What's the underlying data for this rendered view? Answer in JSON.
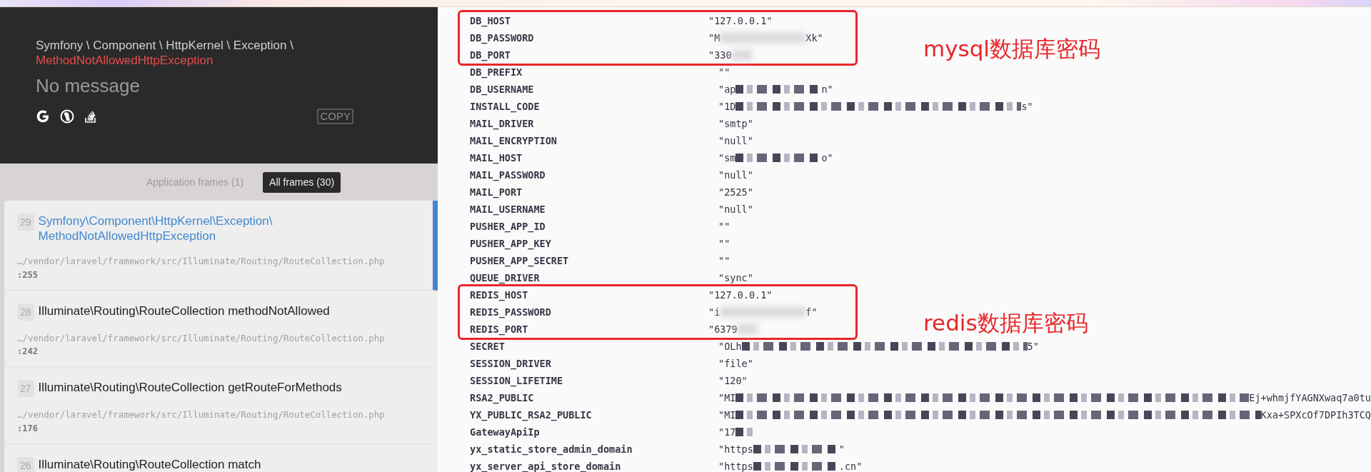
{
  "exception": {
    "namespace": "Symfony \\ Component \\ HttpKernel \\ Exception \\",
    "class": "MethodNotAllowedHttpException",
    "message": "No message",
    "search_links": [
      {
        "kind": "google"
      },
      {
        "kind": "duckduckgo"
      },
      {
        "kind": "stackoverflow"
      }
    ],
    "copy_button": "COPY"
  },
  "frame_tabs": [
    {
      "label": "Application frames (1)",
      "selected": false
    },
    {
      "label": "All frames (30)",
      "selected": true
    }
  ],
  "frames": [
    {
      "index": "29",
      "title": "Symfony\\Component\\HttpKernel\\Exception\\MethodNotAllowedHttpException",
      "file": "…/vendor/laravel/framework/src/Illuminate/Routing/RouteCollection.php",
      "line": ":255",
      "selected": true
    },
    {
      "index": "28",
      "title": "Illuminate\\Routing\\RouteCollection methodNotAllowed",
      "file": "…/vendor/laravel/framework/src/Illuminate/Routing/RouteCollection.php",
      "line": ":242",
      "selected": false
    },
    {
      "index": "27",
      "title": "Illuminate\\Routing\\RouteCollection getRouteForMethods",
      "file": "…/vendor/laravel/framework/src/Illuminate/Routing/RouteCollection.php",
      "line": ":176",
      "selected": false
    },
    {
      "index": "26",
      "title": "Illuminate\\Routing\\RouteCollection match",
      "selected": false
    }
  ],
  "env_groups": [
    {
      "boxed": true,
      "note": "mysql数据库密码",
      "rows": [
        {
          "key": "DB_HOST",
          "kind": "plain",
          "value": "\"127.0.0.1\""
        },
        {
          "key": "DB_PASSWORD",
          "kind": "blurred",
          "before": "\"M",
          "after": "Xk\""
        },
        {
          "key": "DB_PORT",
          "kind": "blurred",
          "before": "\"330"
        }
      ]
    },
    {
      "boxed": false,
      "rows": [
        {
          "key": "DB_PREFIX",
          "kind": "plain",
          "value": "\"\""
        },
        {
          "key": "DB_USERNAME",
          "kind": "pixelated",
          "before": "\"ap",
          "after": "n\""
        },
        {
          "key": "INSTALL_CODE",
          "kind": "longpixelated",
          "before": "\"1D",
          "after": "s\""
        },
        {
          "key": "MAIL_DRIVER",
          "kind": "plain",
          "value": "\"smtp\""
        },
        {
          "key": "MAIL_ENCRYPTION",
          "kind": "plain",
          "value": "\"null\""
        },
        {
          "key": "MAIL_HOST",
          "kind": "pixelated",
          "before": "\"sm",
          "after": "o\""
        },
        {
          "key": "MAIL_PASSWORD",
          "kind": "plain",
          "value": "\"null\""
        },
        {
          "key": "MAIL_PORT",
          "kind": "plain",
          "value": "\"2525\""
        },
        {
          "key": "MAIL_USERNAME",
          "kind": "plain",
          "value": "\"null\""
        },
        {
          "key": "PUSHER_APP_ID",
          "kind": "plain",
          "value": "\"\""
        },
        {
          "key": "PUSHER_APP_KEY",
          "kind": "plain",
          "value": "\"\""
        },
        {
          "key": "PUSHER_APP_SECRET",
          "kind": "plain",
          "value": "\"\""
        },
        {
          "key": "QUEUE_DRIVER",
          "kind": "plain",
          "value": "\"sync\""
        }
      ]
    },
    {
      "boxed": true,
      "note": "redis数据库密码",
      "rows": [
        {
          "key": "REDIS_HOST",
          "kind": "plain",
          "value": "\"127.0.0.1\""
        },
        {
          "key": "REDIS_PASSWORD",
          "kind": "blurred",
          "before": "\"i",
          "after": "f\""
        },
        {
          "key": "REDIS_PORT",
          "kind": "blurred",
          "before": "\"6379"
        }
      ]
    },
    {
      "boxed": false,
      "rows": [
        {
          "key": "SECRET",
          "kind": "longpixelated",
          "before": "\"OLh",
          "after": "5\""
        },
        {
          "key": "SESSION_DRIVER",
          "kind": "plain",
          "value": "\"file\""
        },
        {
          "key": "SESSION_LIFETIME",
          "kind": "plain",
          "value": "\"120\""
        },
        {
          "key": "RSA2_PUBLIC",
          "kind": "edgepixelated",
          "before": "\"MI",
          "after": "Ej+whmjfYAGNXwaq7a0tu"
        },
        {
          "key": "YX_PUBLIC_RSA2_PUBLIC",
          "kind": "edgepixelated",
          "before": "\"MI",
          "after": "Kxa+SPXcOf7DPIh3TCQ"
        },
        {
          "key": "GatewayApiIp",
          "kind": "pixelated",
          "before": "\"17"
        },
        {
          "key": "yx_static_store_admin_domain",
          "kind": "pixelated",
          "before": "\"https",
          "after": "\""
        },
        {
          "key": "yx_server_api_store_domain",
          "kind": "pixelated",
          "before": "\"https",
          "after": ".cn\""
        }
      ]
    }
  ]
}
